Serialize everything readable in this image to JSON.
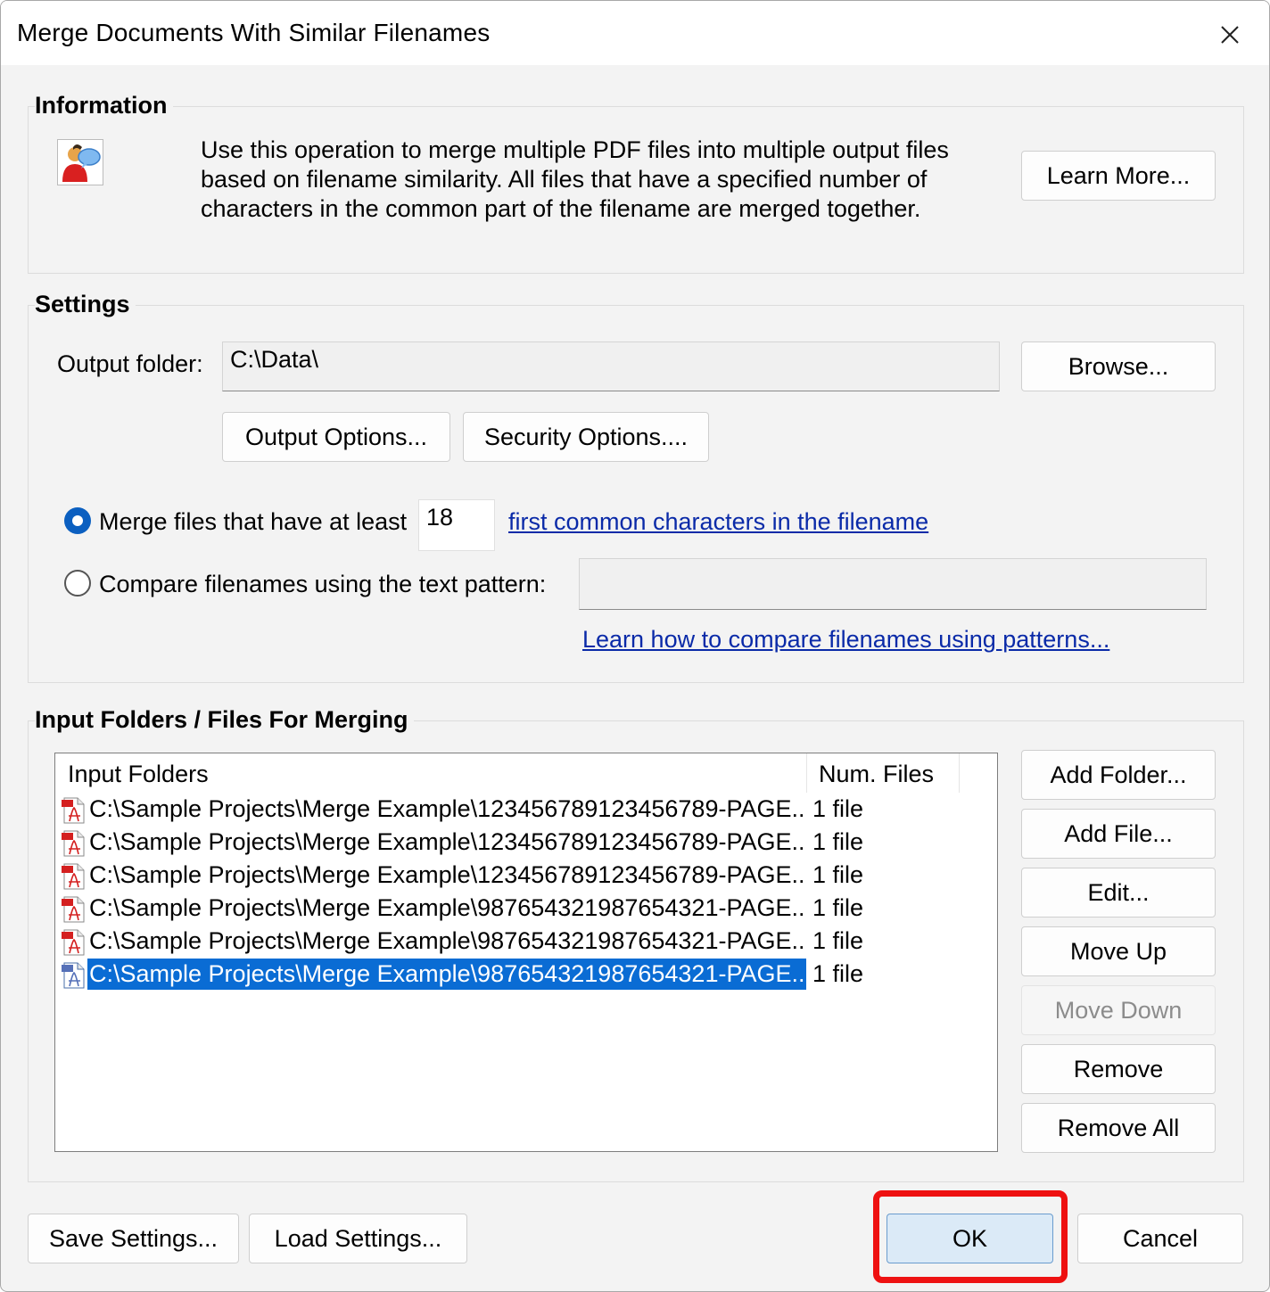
{
  "window": {
    "title": "Merge Documents With Similar Filenames",
    "close_label": "✕"
  },
  "information": {
    "group_title": "Information",
    "description_lines": [
      "Use this operation to merge multiple PDF files into multiple output files",
      "based on filename similarity. All files that have a specified number of",
      "characters in the common part of the filename are merged together."
    ],
    "learn_more_label": "Learn More..."
  },
  "settings": {
    "group_title": "Settings",
    "output_folder_label": "Output folder:",
    "output_folder_value": "C:\\Data\\",
    "browse_label": "Browse...",
    "output_options_label": "Output Options...",
    "security_options_label": "Security Options....",
    "merge_count_label": "Merge files that have at least",
    "merge_count_value": "18",
    "merge_count_link": "first common characters in the filename",
    "pattern_label": "Compare filenames using the text pattern:",
    "pattern_value": "",
    "pattern_link": "Learn how to compare filenames using patterns...",
    "selected_option": "merge_count"
  },
  "input": {
    "group_title": "Input Folders / Files For Merging",
    "columns": [
      "Input Folders",
      "Num. Files"
    ],
    "rows": [
      {
        "path": "C:\\Sample Projects\\Merge Example\\123456789123456789-PAGE...",
        "count": "1 file",
        "selected": false
      },
      {
        "path": "C:\\Sample Projects\\Merge Example\\123456789123456789-PAGE...",
        "count": "1 file",
        "selected": false
      },
      {
        "path": "C:\\Sample Projects\\Merge Example\\123456789123456789-PAGE...",
        "count": "1 file",
        "selected": false
      },
      {
        "path": "C:\\Sample Projects\\Merge Example\\987654321987654321-PAGE...",
        "count": "1 file",
        "selected": false
      },
      {
        "path": "C:\\Sample Projects\\Merge Example\\987654321987654321-PAGE...",
        "count": "1 file",
        "selected": false
      },
      {
        "path": "C:\\Sample Projects\\Merge Example\\987654321987654321-PAGE...",
        "count": "1 file",
        "selected": true
      }
    ],
    "buttons": {
      "add_folder": "Add Folder...",
      "add_file": "Add File...",
      "edit": "Edit...",
      "move_up": "Move Up",
      "move_down": "Move Down",
      "remove": "Remove",
      "remove_all": "Remove All"
    }
  },
  "footer": {
    "save_settings_label": "Save Settings...",
    "load_settings_label": "Load Settings...",
    "ok_label": "OK",
    "cancel_label": "Cancel"
  },
  "colors": {
    "selection": "#0a6cd4",
    "link": "#0a2aa8",
    "highlight_outline": "#ee1111",
    "radio_checked": "#0b5fc0",
    "default_button": "#dbeaf7"
  },
  "icons": {
    "info": "user-help-icon",
    "file": "pdf-file-icon"
  }
}
